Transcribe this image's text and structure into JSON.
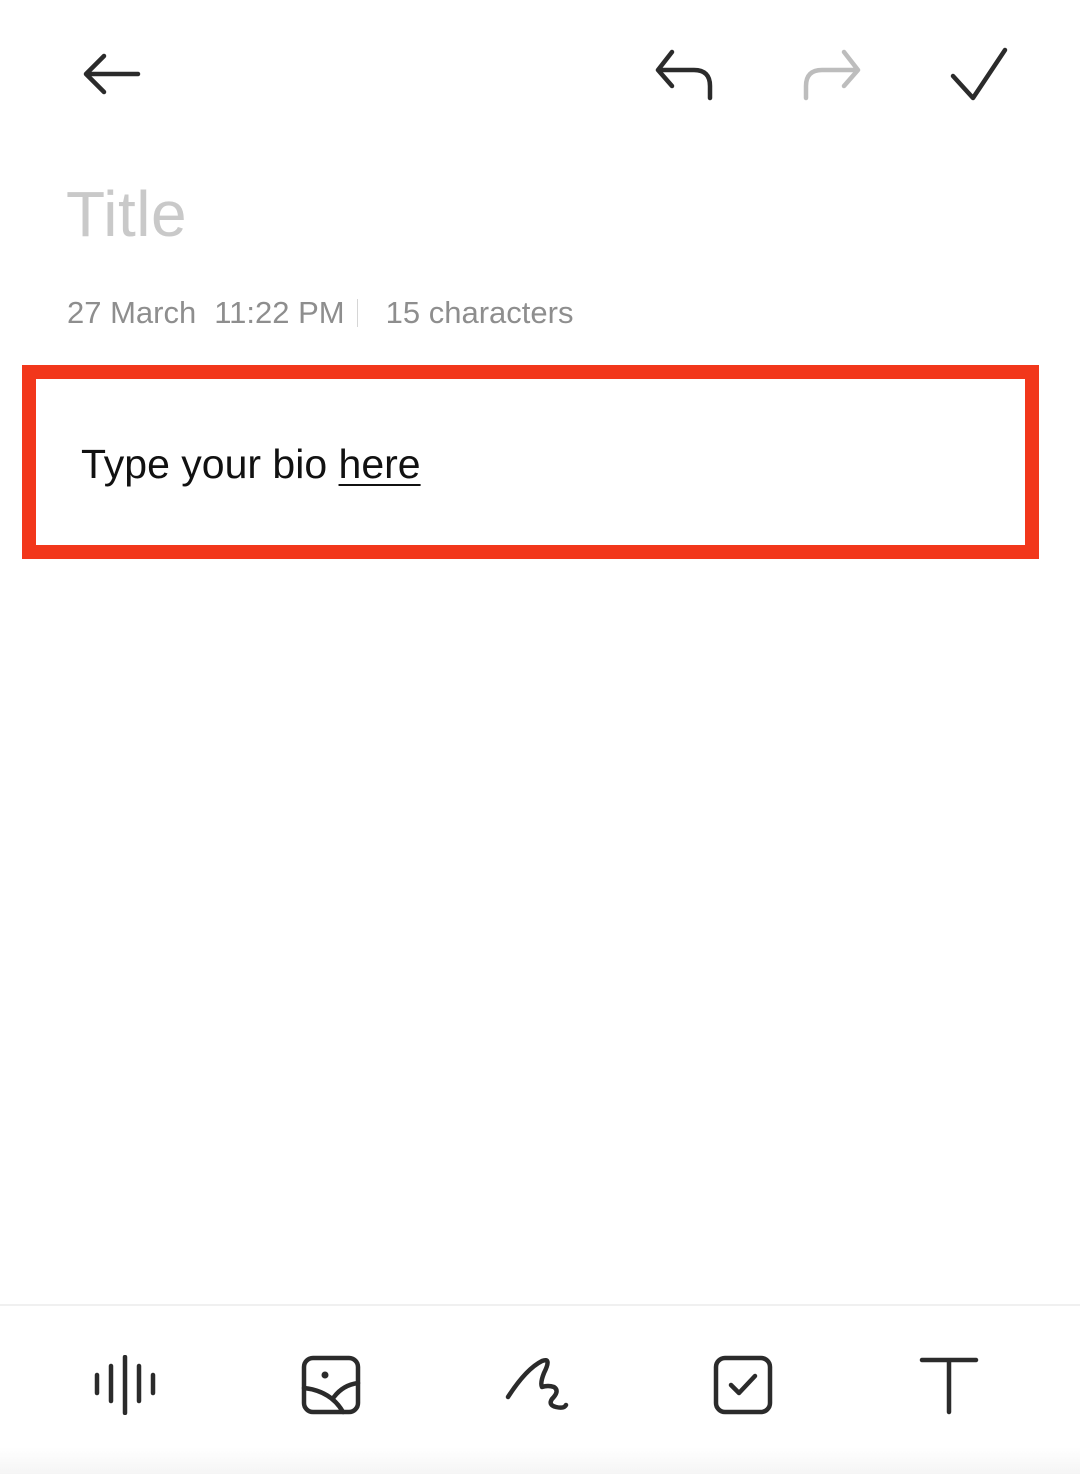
{
  "header": {
    "back": {
      "icon": "arrow-left-icon",
      "label": "Back"
    },
    "undo": {
      "icon": "undo-icon",
      "label": "Undo",
      "enabled": true,
      "color": "#2b2b2b"
    },
    "redo": {
      "icon": "redo-icon",
      "label": "Redo",
      "enabled": false,
      "color": "#bdbdbd"
    },
    "done": {
      "icon": "checkmark-icon",
      "label": "Done"
    }
  },
  "note": {
    "title_placeholder": "Title",
    "meta": {
      "date": "27 March",
      "time": "11:22 PM",
      "char_count": "15 characters"
    },
    "body": {
      "text_plain": "Type your bio ",
      "text_underlined": "here"
    }
  },
  "highlight": {
    "color": "#f2371b"
  },
  "toolbar": {
    "items": [
      {
        "id": "audio",
        "icon": "audio-waveform-icon",
        "label": "Voice recording"
      },
      {
        "id": "image",
        "icon": "image-icon",
        "label": "Insert image"
      },
      {
        "id": "draw",
        "icon": "handwriting-icon",
        "label": "Doodle"
      },
      {
        "id": "check",
        "icon": "checkbox-icon",
        "label": "Checklist"
      },
      {
        "id": "text",
        "icon": "text-format-icon",
        "label": "Text format"
      }
    ]
  }
}
